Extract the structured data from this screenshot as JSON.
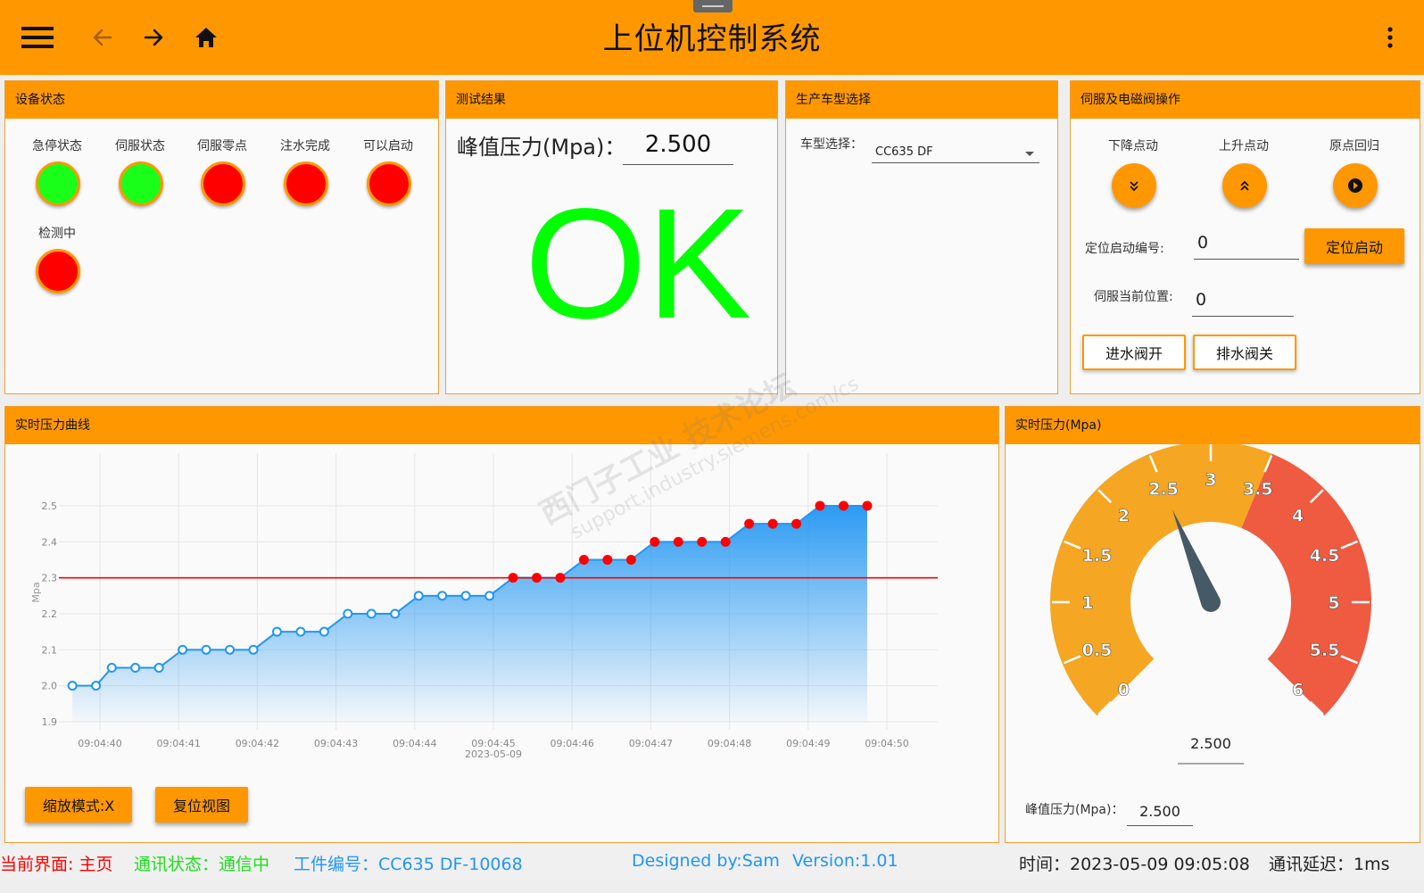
{
  "header": {
    "title": "上位机控制系统"
  },
  "device_status": {
    "title": "设备状态",
    "lamps": [
      {
        "label": "急停状态",
        "state": "on"
      },
      {
        "label": "伺服状态",
        "state": "on"
      },
      {
        "label": "伺服零点",
        "state": "off"
      },
      {
        "label": "注水完成",
        "state": "off"
      },
      {
        "label": "可以启动",
        "state": "off"
      },
      {
        "label": "检测中",
        "state": "off"
      }
    ],
    "colors": {
      "on": "#19ff19",
      "off": "#ff0000"
    }
  },
  "test_result": {
    "title": "测试结果",
    "peak_label": "峰值压力(Mpa)：",
    "peak_value": "2.500",
    "result": "OK"
  },
  "model_select": {
    "title": "生产车型选择",
    "label": "车型选择：",
    "selected": "CC635 DF"
  },
  "servo": {
    "title": "伺服及电磁阀操作",
    "jog_down_label": "下降点动",
    "jog_up_label": "上升点动",
    "home_label": "原点回归",
    "position_no_label": "定位启动编号:",
    "position_no_value": "0",
    "position_start_label": "定位启动",
    "current_pos_label": "伺服当前位置:",
    "current_pos_value": "0",
    "water_in_label": "进水阀开",
    "water_out_label": "排水阀关"
  },
  "pressure_curve": {
    "title": "实时压力曲线",
    "zoom_label": "缩放模式:X",
    "reset_label": "复位视图"
  },
  "gauge": {
    "title": "实时压力(Mpa)",
    "value": 2.5,
    "value_text": "2.500",
    "min": 0,
    "max": 6,
    "danger_from": 3.5,
    "ticks": [
      "0",
      "0.5",
      "1",
      "1.5",
      "2",
      "2.5",
      "3",
      "3.5",
      "4",
      "4.5",
      "5",
      "5.5",
      "6"
    ],
    "peak_label": "峰值压力(Mpa)：",
    "peak_value": "2.500",
    "colors": {
      "normal": "#f5a623",
      "danger": "#ee5b40",
      "needle": "#455a64"
    }
  },
  "status_bar": {
    "page": "当前界面: 主页",
    "comm": "通讯状态：通信中",
    "workpiece": "工件编号：CC635 DF-10068",
    "designer": "Designed by:Sam",
    "version": "Version:1.01",
    "time": "时间：2023-05-09 09:05:08",
    "latency": "通讯延迟：1ms"
  },
  "watermark": {
    "line1": "西门子工业 技术论坛",
    "line2": "support.industry.siemens.com/cs"
  },
  "chart_data": {
    "type": "area",
    "ylabel": "Mpa",
    "xlabel": "",
    "ylim": [
      1.9,
      2.55
    ],
    "yticks": [
      "1.9",
      "2.0",
      "2.1",
      "2.2",
      "2.3",
      "2.4",
      "2.5"
    ],
    "xticks": [
      "09:04:40",
      "09:04:41",
      "09:04:42",
      "09:04:43",
      "09:04:44",
      "09:04:45",
      "09:04:46",
      "09:04:47",
      "09:04:48",
      "09:04:49",
      "09:04:50"
    ],
    "date_label": "2023-05-09",
    "threshold": 2.3,
    "threshold_color": "#ff0000",
    "line_color": "#2196f3",
    "above_color": "#ff0000",
    "x": [
      "09:04:39.65",
      "09:04:39.95",
      "09:04:40.15",
      "09:04:40.45",
      "09:04:40.75",
      "09:04:41.05",
      "09:04:41.35",
      "09:04:41.65",
      "09:04:41.95",
      "09:04:42.25",
      "09:04:42.55",
      "09:04:42.85",
      "09:04:43.15",
      "09:04:43.45",
      "09:04:43.75",
      "09:04:44.05",
      "09:04:44.35",
      "09:04:44.65",
      "09:04:44.95",
      "09:04:45.25",
      "09:04:45.55",
      "09:04:45.85",
      "09:04:46.15",
      "09:04:46.45",
      "09:04:46.75",
      "09:04:47.05",
      "09:04:47.35",
      "09:04:47.65",
      "09:04:47.95",
      "09:04:48.25",
      "09:04:48.55",
      "09:04:48.85",
      "09:04:49.15",
      "09:04:49.45",
      "09:04:49.75"
    ],
    "values": [
      2.0,
      2.0,
      2.05,
      2.05,
      2.05,
      2.1,
      2.1,
      2.1,
      2.1,
      2.15,
      2.15,
      2.15,
      2.2,
      2.2,
      2.2,
      2.25,
      2.25,
      2.25,
      2.25,
      2.3,
      2.3,
      2.3,
      2.35,
      2.35,
      2.35,
      2.4,
      2.4,
      2.4,
      2.4,
      2.45,
      2.45,
      2.45,
      2.5,
      2.5,
      2.5
    ]
  }
}
